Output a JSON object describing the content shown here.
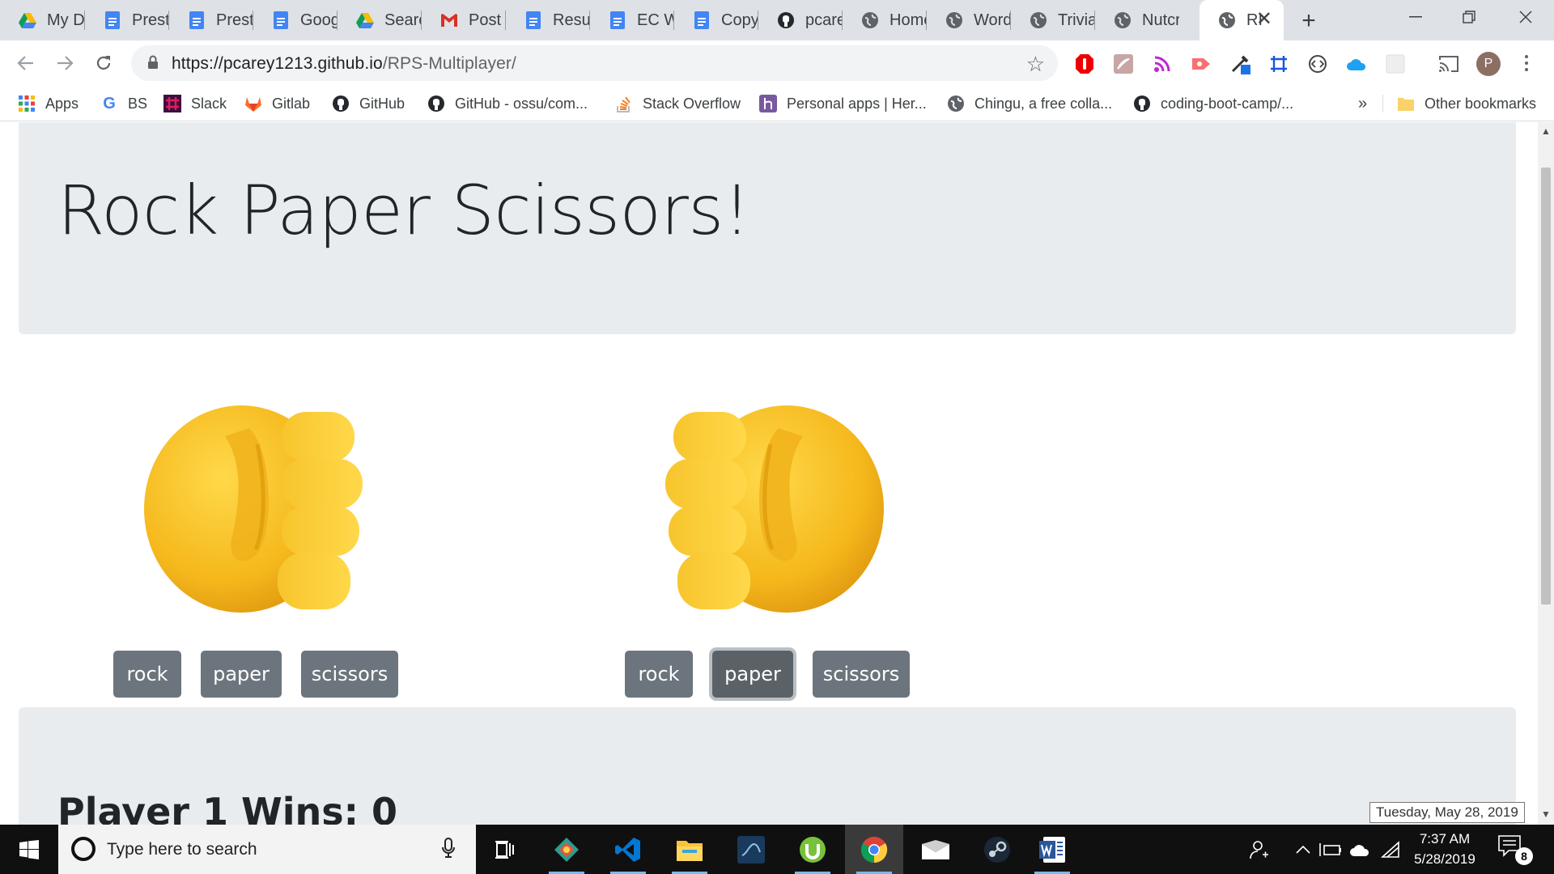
{
  "browser": {
    "tabs": [
      {
        "label": "My Dr",
        "icon": "google-drive-icon"
      },
      {
        "label": "Presto",
        "icon": "google-docs-icon"
      },
      {
        "label": "Presto",
        "icon": "google-docs-icon"
      },
      {
        "label": "Googl",
        "icon": "google-docs-icon"
      },
      {
        "label": "Search",
        "icon": "google-drive-icon"
      },
      {
        "label": "Post C",
        "icon": "gmail-icon"
      },
      {
        "label": "Resun",
        "icon": "google-docs-icon"
      },
      {
        "label": "EC W",
        "icon": "google-docs-icon"
      },
      {
        "label": "Copy",
        "icon": "google-docs-icon"
      },
      {
        "label": "pcare",
        "icon": "github-icon"
      },
      {
        "label": "Home",
        "icon": "globe-icon"
      },
      {
        "label": "Word",
        "icon": "globe-icon"
      },
      {
        "label": "Trivia",
        "icon": "globe-icon"
      },
      {
        "label": "Nutcr",
        "icon": "globe-icon"
      },
      {
        "label": "RI",
        "icon": "globe-icon",
        "active": true
      }
    ],
    "url_host": "https://pcarey1213.github.io",
    "url_path": "/RPS-Multiplayer/",
    "profile_initial": "P",
    "bookmarks": [
      {
        "label": "Apps",
        "icon": "apps-grid-icon"
      },
      {
        "label": "BS",
        "icon": "google-icon"
      },
      {
        "label": "Slack",
        "icon": "slack-icon"
      },
      {
        "label": "Gitlab",
        "icon": "gitlab-icon"
      },
      {
        "label": "GitHub",
        "icon": "github-icon"
      },
      {
        "label": "GitHub - ossu/com...",
        "icon": "github-icon"
      },
      {
        "label": "Stack Overflow",
        "icon": "stack-overflow-icon"
      },
      {
        "label": "Personal apps | Her...",
        "icon": "heroku-icon"
      },
      {
        "label": "Chingu, a free colla...",
        "icon": "globe-icon"
      },
      {
        "label": "coding-boot-camp/...",
        "icon": "github-icon"
      }
    ],
    "bookmarks_overflow": "»",
    "other_bookmarks": "Other bookmarks"
  },
  "page": {
    "title": "Rock Paper Scissors!",
    "player1": {
      "buttons": [
        "rock",
        "paper",
        "scissors"
      ]
    },
    "player2": {
      "buttons": [
        "rock",
        "paper",
        "scissors"
      ],
      "focused": "paper"
    },
    "score_heading": "Player 1 Wins: 0"
  },
  "tooltip": "Tuesday, May 28, 2019",
  "taskbar": {
    "search_placeholder": "Type here to search",
    "time": "7:37 AM",
    "date": "5/28/2019",
    "notification_count": "8"
  },
  "colors": {
    "jumbotron_bg": "#e9ecef",
    "button_bg": "#6c757d",
    "emoji_fist": "#f7c12a"
  }
}
